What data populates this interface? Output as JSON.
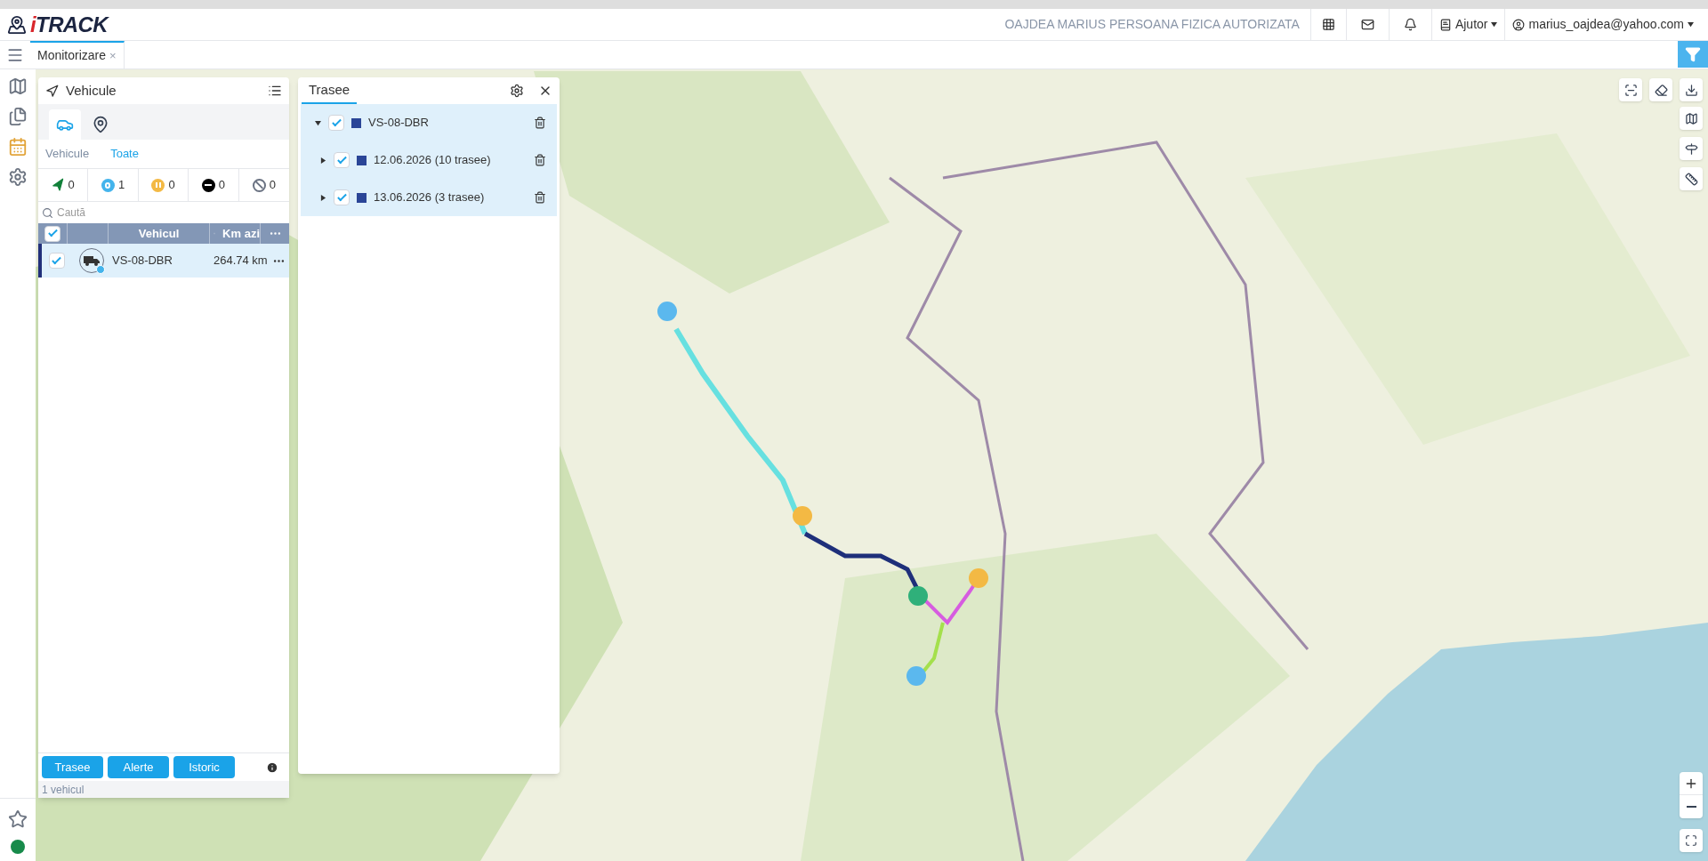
{
  "header": {
    "logo_accent": "i",
    "logo_text": "TRACK",
    "company": "OAJDEA MARIUS PERSOANA FIZICA AUTORIZATA",
    "help": "Ajutor",
    "user": "marius_oajdea@yahoo.com"
  },
  "tabs": [
    {
      "label": "Monitorizare",
      "close": "×",
      "selected": true
    }
  ],
  "vehicles_panel": {
    "title": "Vehicule",
    "view_tabs": [
      {
        "kind": "car",
        "selected": true
      },
      {
        "kind": "pin",
        "selected": false
      }
    ],
    "filter_links": [
      {
        "label": "Vehicule",
        "selected": false
      },
      {
        "label": "Toate",
        "selected": true
      }
    ],
    "status_counts": [
      {
        "kind": "moving",
        "count": "0"
      },
      {
        "kind": "parked",
        "count": "1"
      },
      {
        "kind": "idle",
        "count": "0"
      },
      {
        "kind": "stopped",
        "count": "0"
      },
      {
        "kind": "no_signal",
        "count": "0"
      }
    ],
    "search": {
      "placeholder": "Caută"
    },
    "table": {
      "all_checked": true,
      "columns": [
        "Vehicul",
        "Km azi"
      ],
      "rows": [
        {
          "vehicle": "VS-08-DBR",
          "km_today": "264.74 km",
          "checked": true,
          "selected": true
        }
      ]
    },
    "buttons": [
      "Trasee",
      "Alerte",
      "Istoric"
    ],
    "footer": "1 vehicul"
  },
  "routes_panel": {
    "tab": {
      "label": "Trasee",
      "selected": true
    },
    "tree": [
      {
        "label": "VS-08-DBR",
        "checked": true,
        "expanded": true,
        "children": [
          {
            "label": "12.06.2026 (10 trasee)",
            "checked": true,
            "expanded": false
          },
          {
            "label": "13.06.2026 (3 trasee)",
            "checked": true,
            "expanded": false
          }
        ]
      }
    ]
  }
}
